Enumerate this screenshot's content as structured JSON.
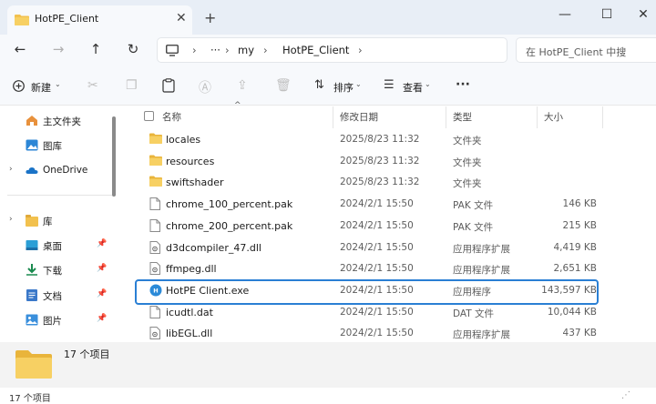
{
  "window": {
    "tab_title": "HotPE_Client",
    "tab_close": "✕",
    "new_tab": "+",
    "minimize": "—",
    "maximize": "☐",
    "close": "✕"
  },
  "address": {
    "back": "←",
    "forward": "→",
    "up": "↑",
    "refresh": "↻",
    "more": "···",
    "crumbs": [
      "my",
      "HotPE_Client"
    ],
    "sep": "›",
    "search_placeholder": "在 HotPE_Client 中搜"
  },
  "toolbar": {
    "new_label": "新建",
    "sort_label": "排序",
    "view_label": "查看",
    "more": "···"
  },
  "sidebar": {
    "items": [
      {
        "label": "主文件夹",
        "icon": "home-icon",
        "chev": ""
      },
      {
        "label": "图库",
        "icon": "gallery-icon",
        "chev": ""
      },
      {
        "label": "OneDrive",
        "icon": "cloud-icon",
        "chev": "›"
      },
      {
        "label": "库",
        "icon": "library-icon",
        "chev": "›"
      },
      {
        "label": "桌面",
        "icon": "desktop-icon",
        "chev": "",
        "pin": true
      },
      {
        "label": "下载",
        "icon": "download-icon",
        "chev": "",
        "pin": true
      },
      {
        "label": "文档",
        "icon": "document-icon",
        "chev": "",
        "pin": true
      },
      {
        "label": "图片",
        "icon": "pictures-icon",
        "chev": "",
        "pin": true
      }
    ]
  },
  "columns": {
    "name": "名称",
    "modified": "修改日期",
    "type": "类型",
    "size": "大小"
  },
  "files": [
    {
      "name": "locales",
      "date": "2025/8/23 11:32",
      "type": "文件夹",
      "size": "",
      "icon": "folder"
    },
    {
      "name": "resources",
      "date": "2025/8/23 11:32",
      "type": "文件夹",
      "size": "",
      "icon": "folder"
    },
    {
      "name": "swiftshader",
      "date": "2025/8/23 11:32",
      "type": "文件夹",
      "size": "",
      "icon": "folder"
    },
    {
      "name": "chrome_100_percent.pak",
      "date": "2024/2/1 15:50",
      "type": "PAK 文件",
      "size": "146 KB",
      "icon": "file"
    },
    {
      "name": "chrome_200_percent.pak",
      "date": "2024/2/1 15:50",
      "type": "PAK 文件",
      "size": "215 KB",
      "icon": "file"
    },
    {
      "name": "d3dcompiler_47.dll",
      "date": "2024/2/1 15:50",
      "type": "应用程序扩展",
      "size": "4,419 KB",
      "icon": "dll"
    },
    {
      "name": "ffmpeg.dll",
      "date": "2024/2/1 15:50",
      "type": "应用程序扩展",
      "size": "2,651 KB",
      "icon": "dll"
    },
    {
      "name": "HotPE Client.exe",
      "date": "2024/2/1 15:50",
      "type": "应用程序",
      "size": "143,597 KB",
      "icon": "exe"
    },
    {
      "name": "icudtl.dat",
      "date": "2024/2/1 15:50",
      "type": "DAT 文件",
      "size": "10,044 KB",
      "icon": "file"
    },
    {
      "name": "libEGL.dll",
      "date": "2024/2/1 15:50",
      "type": "应用程序扩展",
      "size": "437 KB",
      "icon": "dll"
    }
  ],
  "info": {
    "count": "17 个项目"
  },
  "status": {
    "count": "17 个项目"
  },
  "colors": {
    "accent": "#2a7fd4",
    "folder": "#f2c14e"
  }
}
